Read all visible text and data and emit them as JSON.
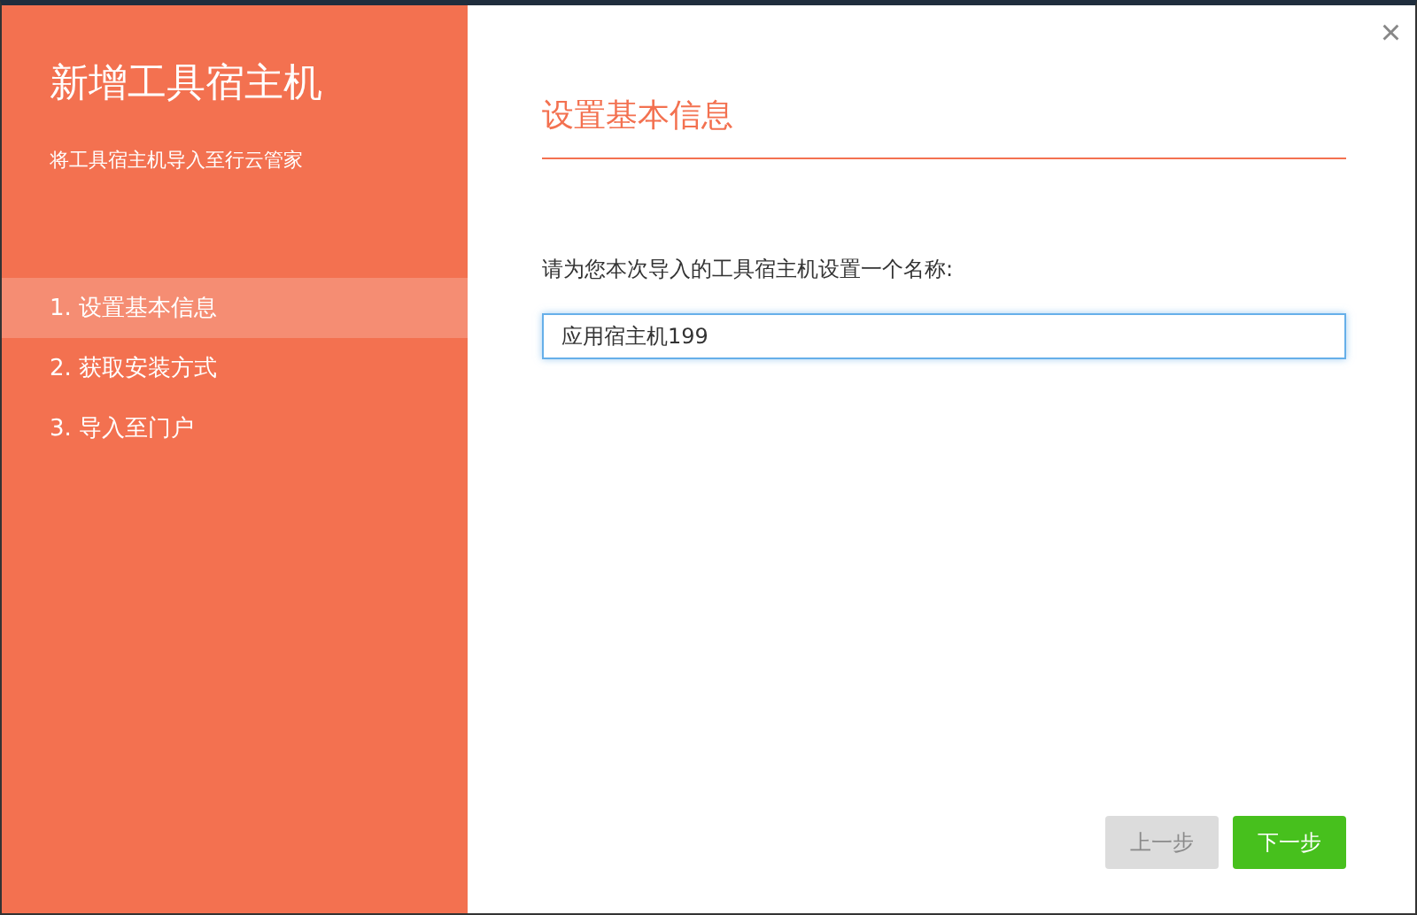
{
  "sidebar": {
    "title": "新增工具宿主机",
    "subtitle": "将工具宿主机导入至行云管家",
    "steps": [
      {
        "label": "1. 设置基本信息",
        "selected": true
      },
      {
        "label": "2. 获取安装方式",
        "selected": false
      },
      {
        "label": "3. 导入至门户",
        "selected": false
      }
    ]
  },
  "close": "×",
  "section_title": "设置基本信息",
  "name_field": {
    "label": "请为您本次导入的工具宿主机设置一个名称:",
    "value": "应用宿主机199"
  },
  "buttons": [
    {
      "label": "上一步",
      "disabled": true
    },
    {
      "label": "下一步",
      "disabled": false
    }
  ]
}
